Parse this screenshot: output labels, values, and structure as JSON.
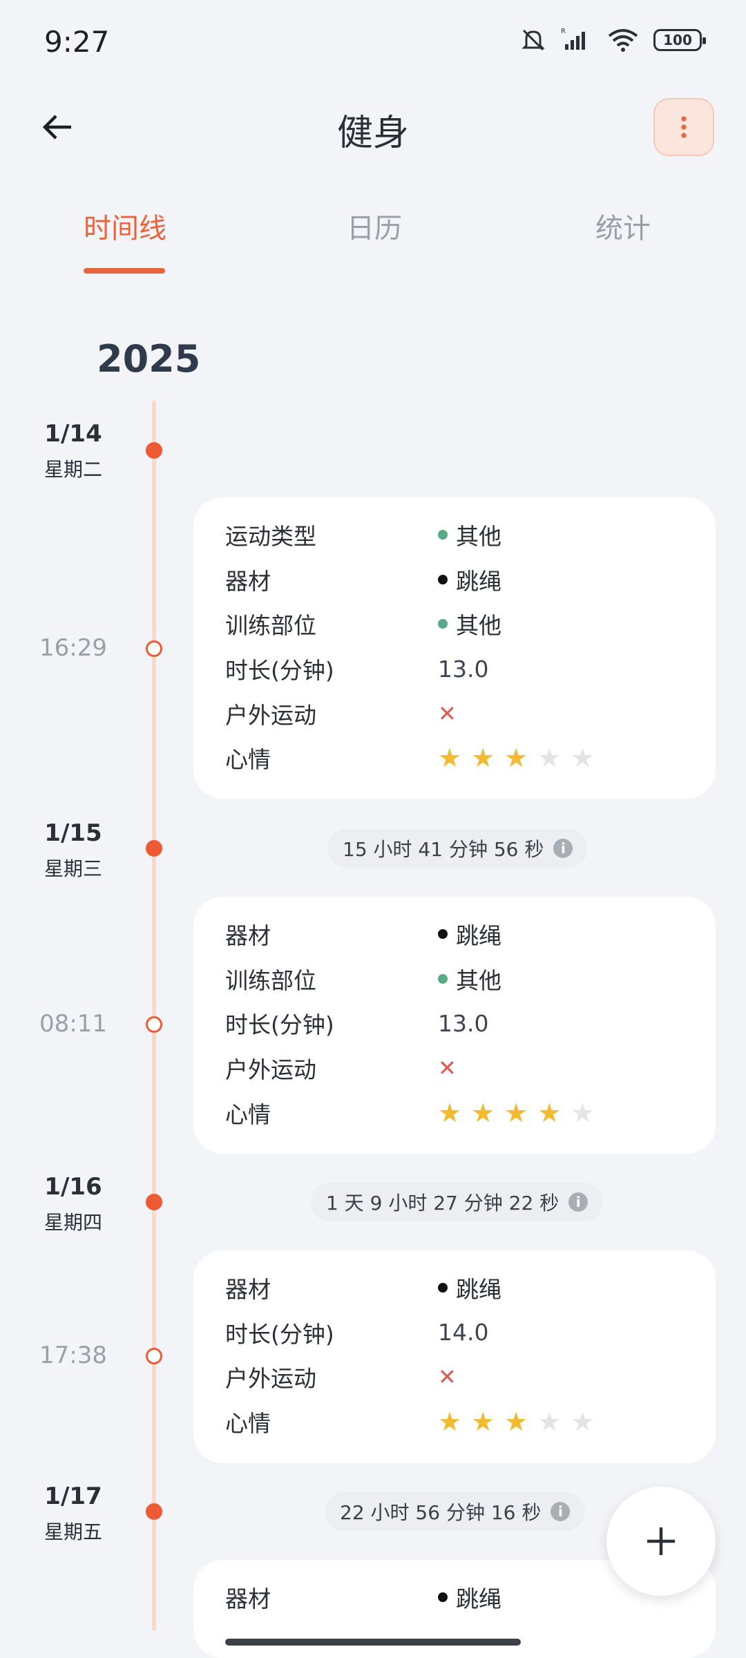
{
  "status": {
    "time": "9:27",
    "battery": "100"
  },
  "header": {
    "title": "健身"
  },
  "tabs": [
    "时间线",
    "日历",
    "统计"
  ],
  "year": "2025",
  "days": [
    {
      "date": "1/14",
      "weekday": "星期二",
      "time": "16:29",
      "rows": [
        {
          "label": "运动类型",
          "value": "其他",
          "dot": "#5aa987"
        },
        {
          "label": "器材",
          "value": "跳绳",
          "dot": "#111111"
        },
        {
          "label": "训练部位",
          "value": "其他",
          "dot": "#5aa987"
        },
        {
          "label": "时长(分钟)",
          "value": "13.0"
        },
        {
          "label": "户外运动",
          "value": "✕"
        },
        {
          "label": "心情",
          "stars": 3
        }
      ]
    },
    {
      "date": "1/15",
      "weekday": "星期三",
      "gap": "15 小时 41 分钟 56 秒",
      "time": "08:11",
      "rows": [
        {
          "label": "器材",
          "value": "跳绳",
          "dot": "#111111"
        },
        {
          "label": "训练部位",
          "value": "其他",
          "dot": "#5aa987"
        },
        {
          "label": "时长(分钟)",
          "value": "13.0"
        },
        {
          "label": "户外运动",
          "value": "✕"
        },
        {
          "label": "心情",
          "stars": 4
        }
      ]
    },
    {
      "date": "1/16",
      "weekday": "星期四",
      "gap": "1 天 9 小时 27 分钟 22 秒",
      "time": "17:38",
      "rows": [
        {
          "label": "器材",
          "value": "跳绳",
          "dot": "#111111"
        },
        {
          "label": "时长(分钟)",
          "value": "14.0"
        },
        {
          "label": "户外运动",
          "value": "✕"
        },
        {
          "label": "心情",
          "stars": 3
        }
      ]
    },
    {
      "date": "1/17",
      "weekday": "星期五",
      "gap": "22 小时 56 分钟 16 秒",
      "rows": [
        {
          "label": "器材",
          "value": "跳绳",
          "dot": "#111111"
        }
      ]
    }
  ],
  "icons": {
    "back": "arrow-left-icon",
    "more": "more-vert-icon",
    "add": "plus-icon",
    "info": "info-icon"
  },
  "colors": {
    "accent": "#e8643c",
    "star": "#f2bb2f"
  }
}
